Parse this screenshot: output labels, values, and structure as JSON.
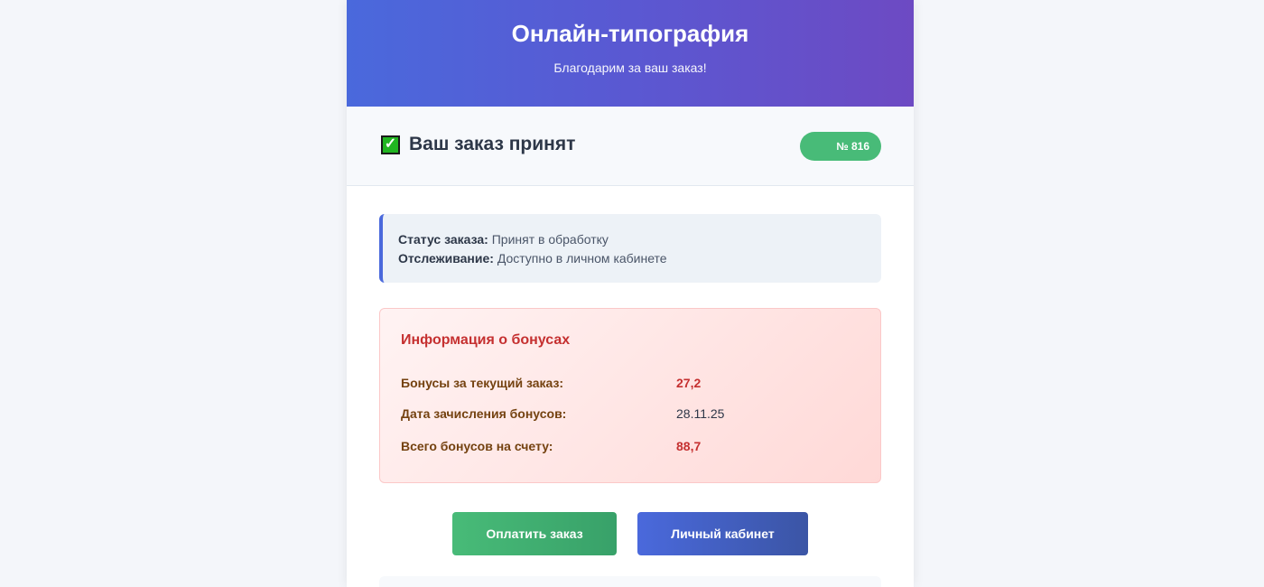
{
  "header": {
    "title": "Онлайн-типография",
    "subtitle": "Благодарим за ваш заказ!"
  },
  "order": {
    "icon": "check-mark-icon",
    "heading": "Ваш заказ принят",
    "number_badge": "№ 816"
  },
  "status": {
    "status_label": "Статус заказа:",
    "status_value": "Принят в обработку",
    "tracking_label": "Отслеживание:",
    "tracking_value": "Доступно в личном кабинете"
  },
  "bonuses": {
    "title": "Информация о бонусах",
    "rows": [
      {
        "label": "Бонусы за текущий заказ:",
        "value": "27,2"
      },
      {
        "label": "Дата зачисления бонусов:",
        "value": "28.11.25"
      },
      {
        "label": "Всего бонусов на счету:",
        "value": "88,7"
      }
    ]
  },
  "actions": {
    "pay_label": "Оплатить заказ",
    "account_label": "Личный кабинет"
  },
  "colors": {
    "accent": "#4a69dc",
    "success": "#48bb78",
    "bonus_red": "#c53030"
  }
}
